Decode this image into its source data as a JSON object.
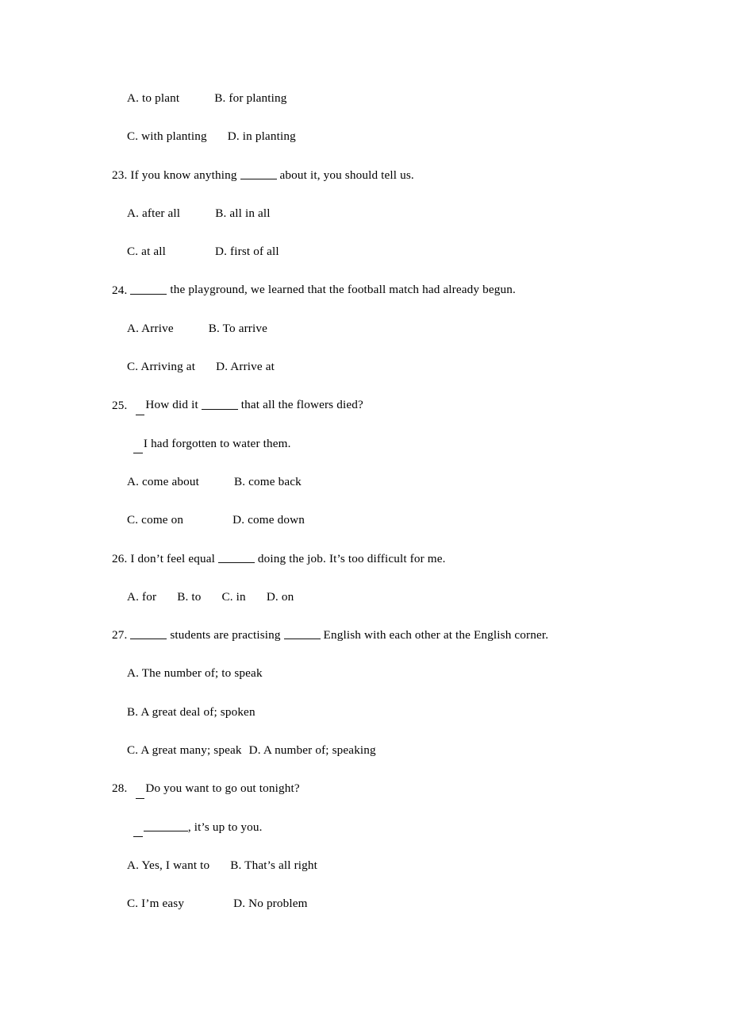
{
  "document": {
    "type": "english-grammar-multiple-choice-worksheet",
    "page_background": "#ffffff",
    "text_color": "#000000"
  },
  "questions": [
    {
      "number": "",
      "stem": "",
      "option_lines": [
        {
          "left": "A. to plant",
          "right": "B. for planting"
        },
        {
          "left": "C. with planting",
          "right": "D. in planting"
        }
      ]
    },
    {
      "number": "23.",
      "stem_before": " If you know anything ",
      "stem_after": " about it, you should tell us.",
      "option_lines": [
        {
          "left": "A. after all",
          "right": "B. all in all"
        },
        {
          "left": "C. at all",
          "right": "D. first of all"
        }
      ]
    },
    {
      "number": "24.",
      "stem_before": " ",
      "stem_after": " the playground, we learned that the football match had already begun.",
      "option_lines": [
        {
          "left": "A. Arrive",
          "right": "B. To arrive"
        },
        {
          "left": "C. Arriving at",
          "right": "D. Arrive at"
        }
      ]
    },
    {
      "number": "25.",
      "stem_before": "How did it ",
      "stem_after": " that all the flowers died?",
      "reply": "I had forgotten to water them.",
      "option_lines": [
        {
          "left": "A. come about",
          "right": "B. come back"
        },
        {
          "left": "C. come on",
          "right": "D. come down"
        }
      ]
    },
    {
      "number": "26.",
      "stem_before": " I don’t feel equal ",
      "stem_after": " doing the job. It’s too difficult for me.",
      "options_inline": [
        "A. for",
        "B. to",
        "C. in",
        "D. on"
      ]
    },
    {
      "number": "27.",
      "stem_part1": " ",
      "stem_part2": " students are practising ",
      "stem_part3": " English with each other at the English corner.",
      "option_lines_single": [
        "A. The number of; to speak",
        "B. A great deal of; spoken"
      ],
      "option_line_pair": {
        "left": "C. A great many; speak",
        "right": "D. A number of; speaking"
      }
    },
    {
      "number": "28.",
      "stem": "Do you want to go out tonight?",
      "reply_after": ", it’s up to you.",
      "option_lines": [
        {
          "left": "A. Yes, I want to",
          "right": "B. That’s all right"
        },
        {
          "left": "C. I’m easy",
          "right": "D. No problem"
        }
      ]
    }
  ]
}
